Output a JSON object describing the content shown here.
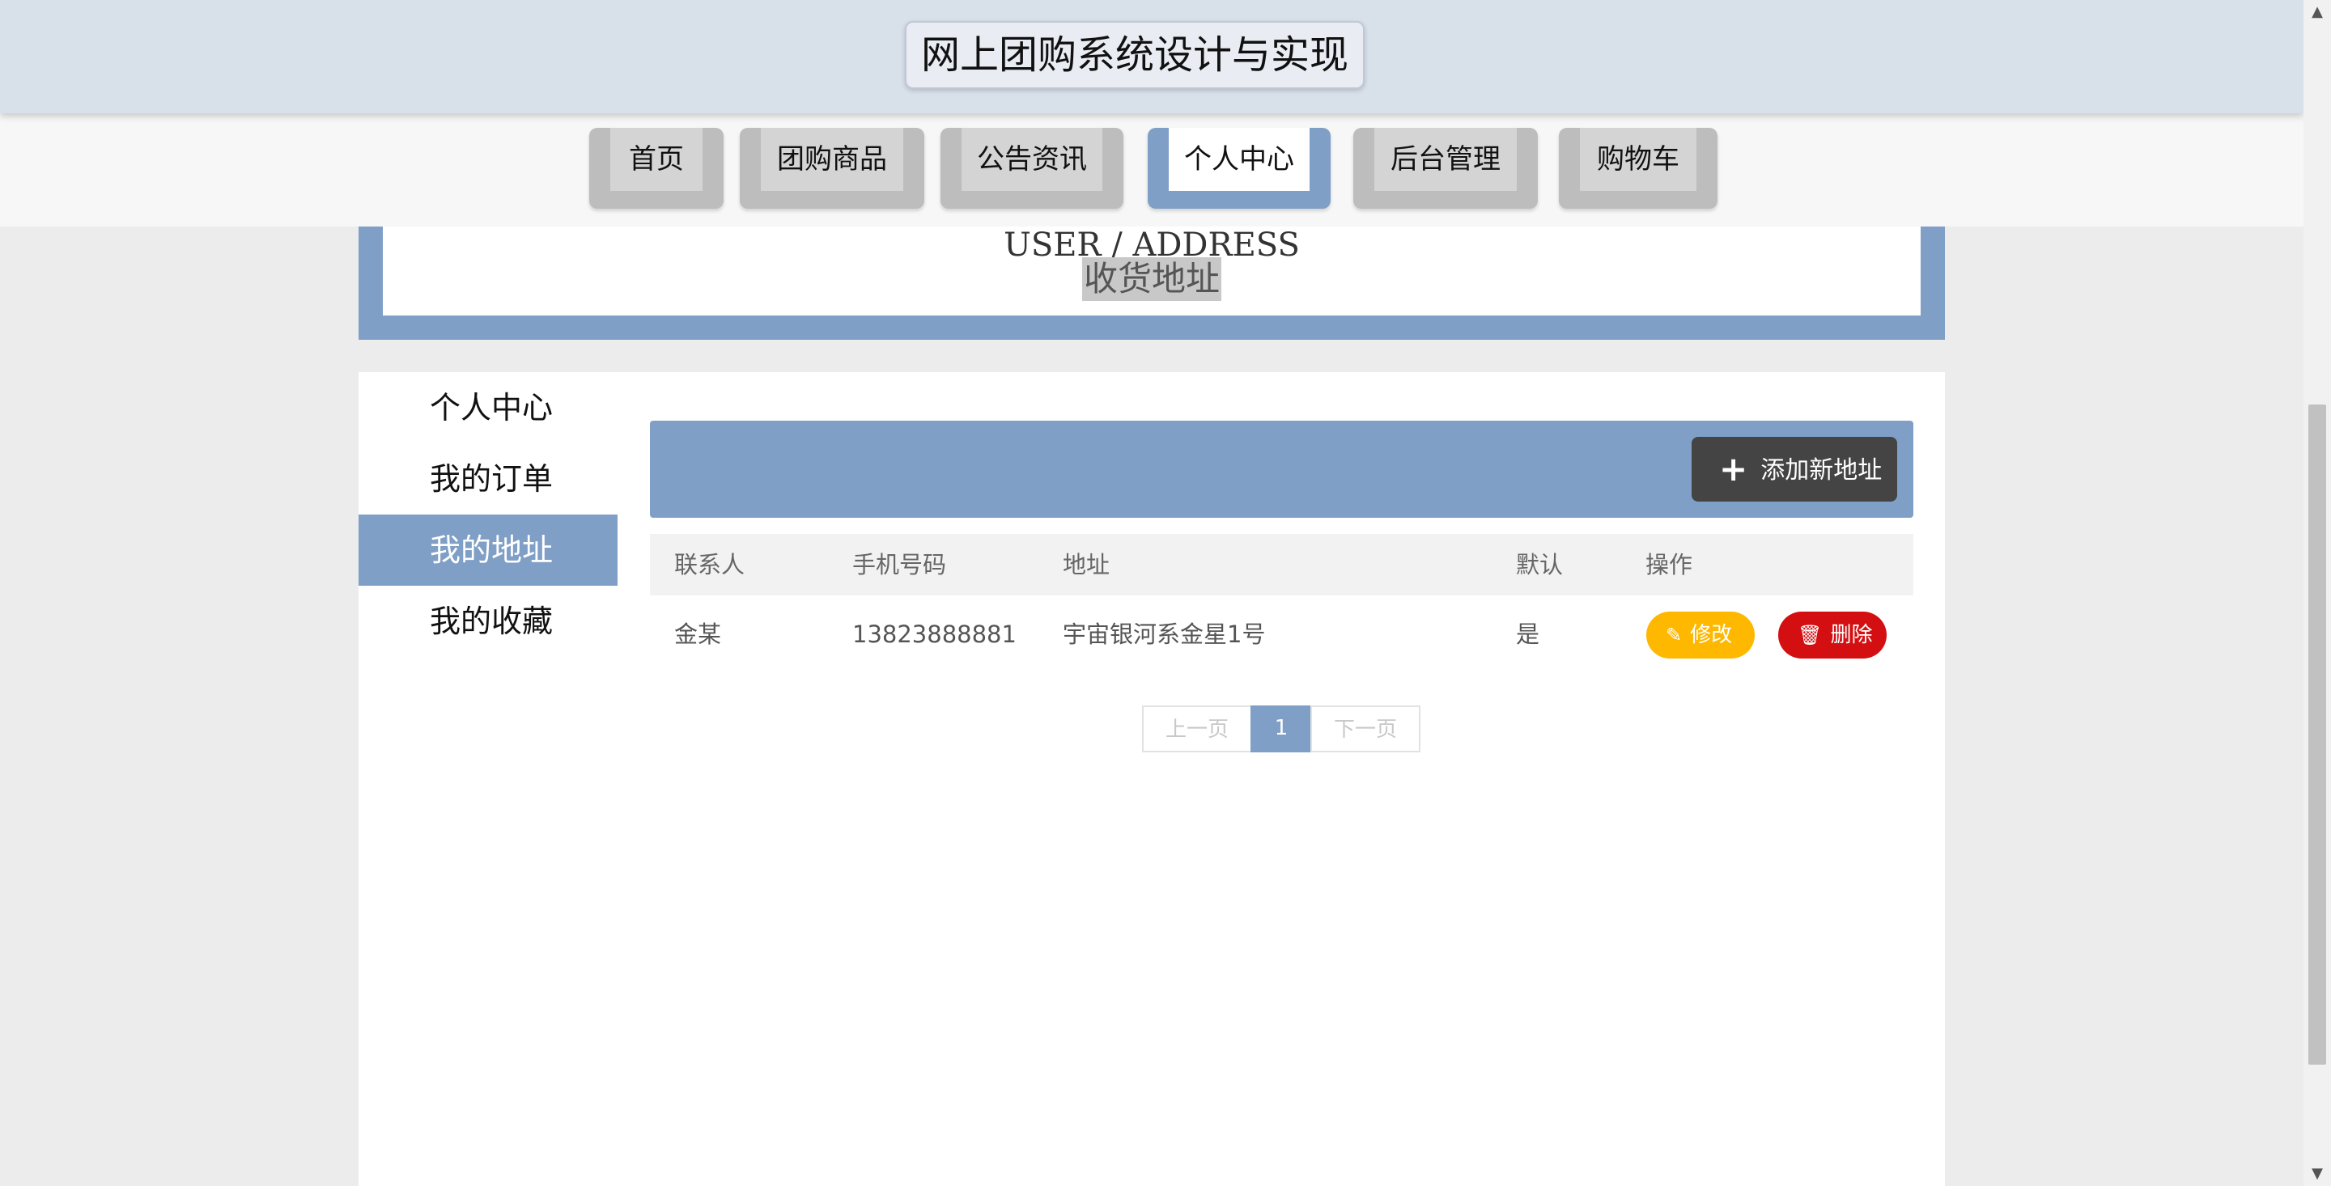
{
  "site": {
    "title": "网上团购系统设计与实现"
  },
  "nav": {
    "items": [
      {
        "label": "首页"
      },
      {
        "label": "团购商品"
      },
      {
        "label": "公告资讯"
      },
      {
        "label": "个人中心",
        "active": true
      },
      {
        "label": "后台管理"
      },
      {
        "label": "购物车"
      }
    ]
  },
  "banner": {
    "en": "USER / ADDRESS",
    "cn": "收货地址"
  },
  "sidebar": {
    "items": [
      {
        "label": "个人中心"
      },
      {
        "label": "我的订单"
      },
      {
        "label": "我的地址",
        "active": true
      },
      {
        "label": "我的收藏"
      }
    ]
  },
  "toolbar": {
    "add_label": "添加新地址"
  },
  "table": {
    "headers": [
      "联系人",
      "手机号码",
      "地址",
      "默认",
      "操作"
    ],
    "rows": [
      {
        "contact": "金某",
        "phone": "13823888881",
        "address": "宇宙银河系金星1号",
        "default": "是",
        "edit_label": "修改",
        "delete_label": "删除"
      }
    ]
  },
  "pagination": {
    "prev": "上一页",
    "current": "1",
    "next": "下一页"
  },
  "colors": {
    "accent": "#7f9fc6",
    "edit": "#ffb800",
    "delete": "#d40f12",
    "add_button": "#444444"
  }
}
